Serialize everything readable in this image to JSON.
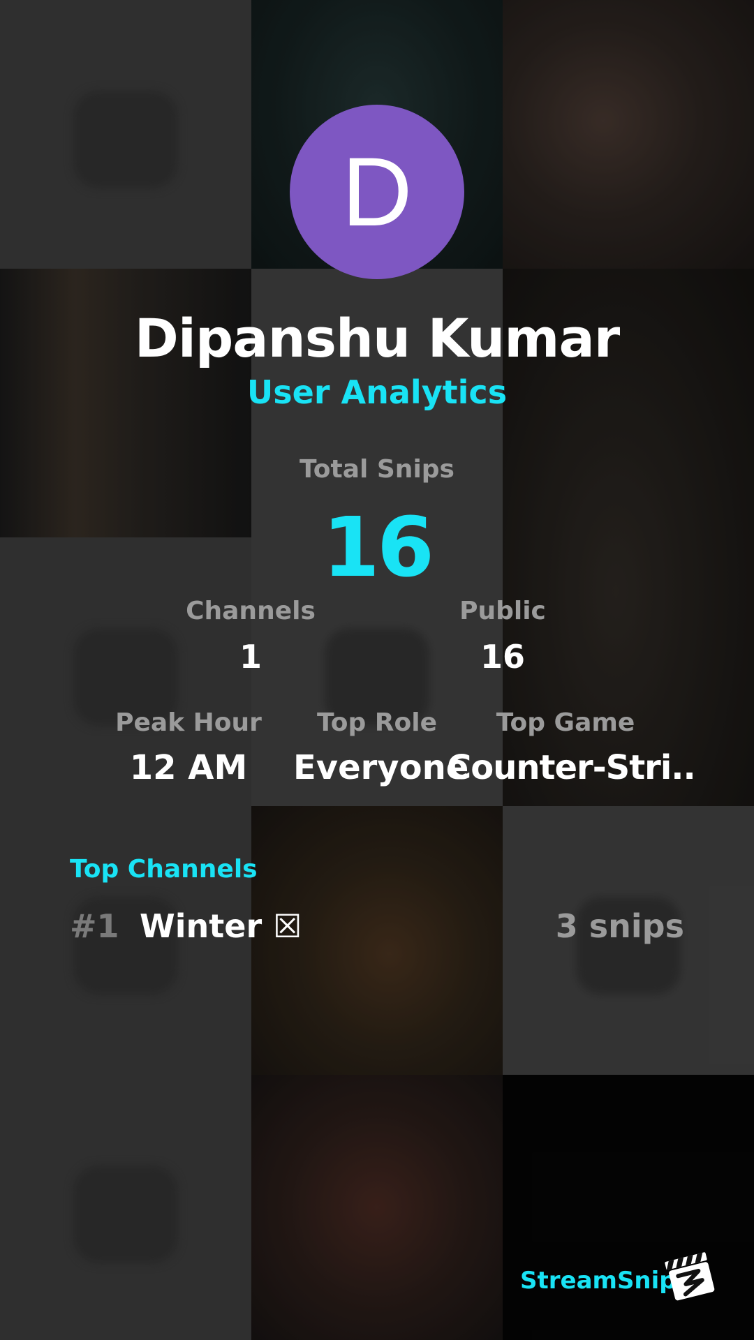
{
  "profile": {
    "avatar_letter": "D",
    "name": "Dipanshu Kumar",
    "subtitle": "User Analytics",
    "avatar_color": "#7e57c2"
  },
  "total": {
    "label": "Total Snips",
    "value": "16"
  },
  "stats": {
    "channels": {
      "label": "Channels",
      "value": "1"
    },
    "public": {
      "label": "Public",
      "value": "16"
    },
    "peak_hour": {
      "label": "Peak Hour",
      "value": "12 AM"
    },
    "top_role": {
      "label": "Top Role",
      "value": "Everyone"
    },
    "top_game": {
      "label": "Top Game",
      "value": "Counter-Stri.."
    }
  },
  "top_channels": {
    "title": "Top Channels",
    "items": [
      {
        "rank": "#1",
        "name": "Winter ☒",
        "count": "3 snips"
      }
    ]
  },
  "brand": {
    "name": "StreamSnip",
    "logo_icon": "clapperboard-icon"
  },
  "theme": {
    "accent": "#19e3f5",
    "muted_text": "#9b9b9b",
    "text": "#ffffff"
  }
}
